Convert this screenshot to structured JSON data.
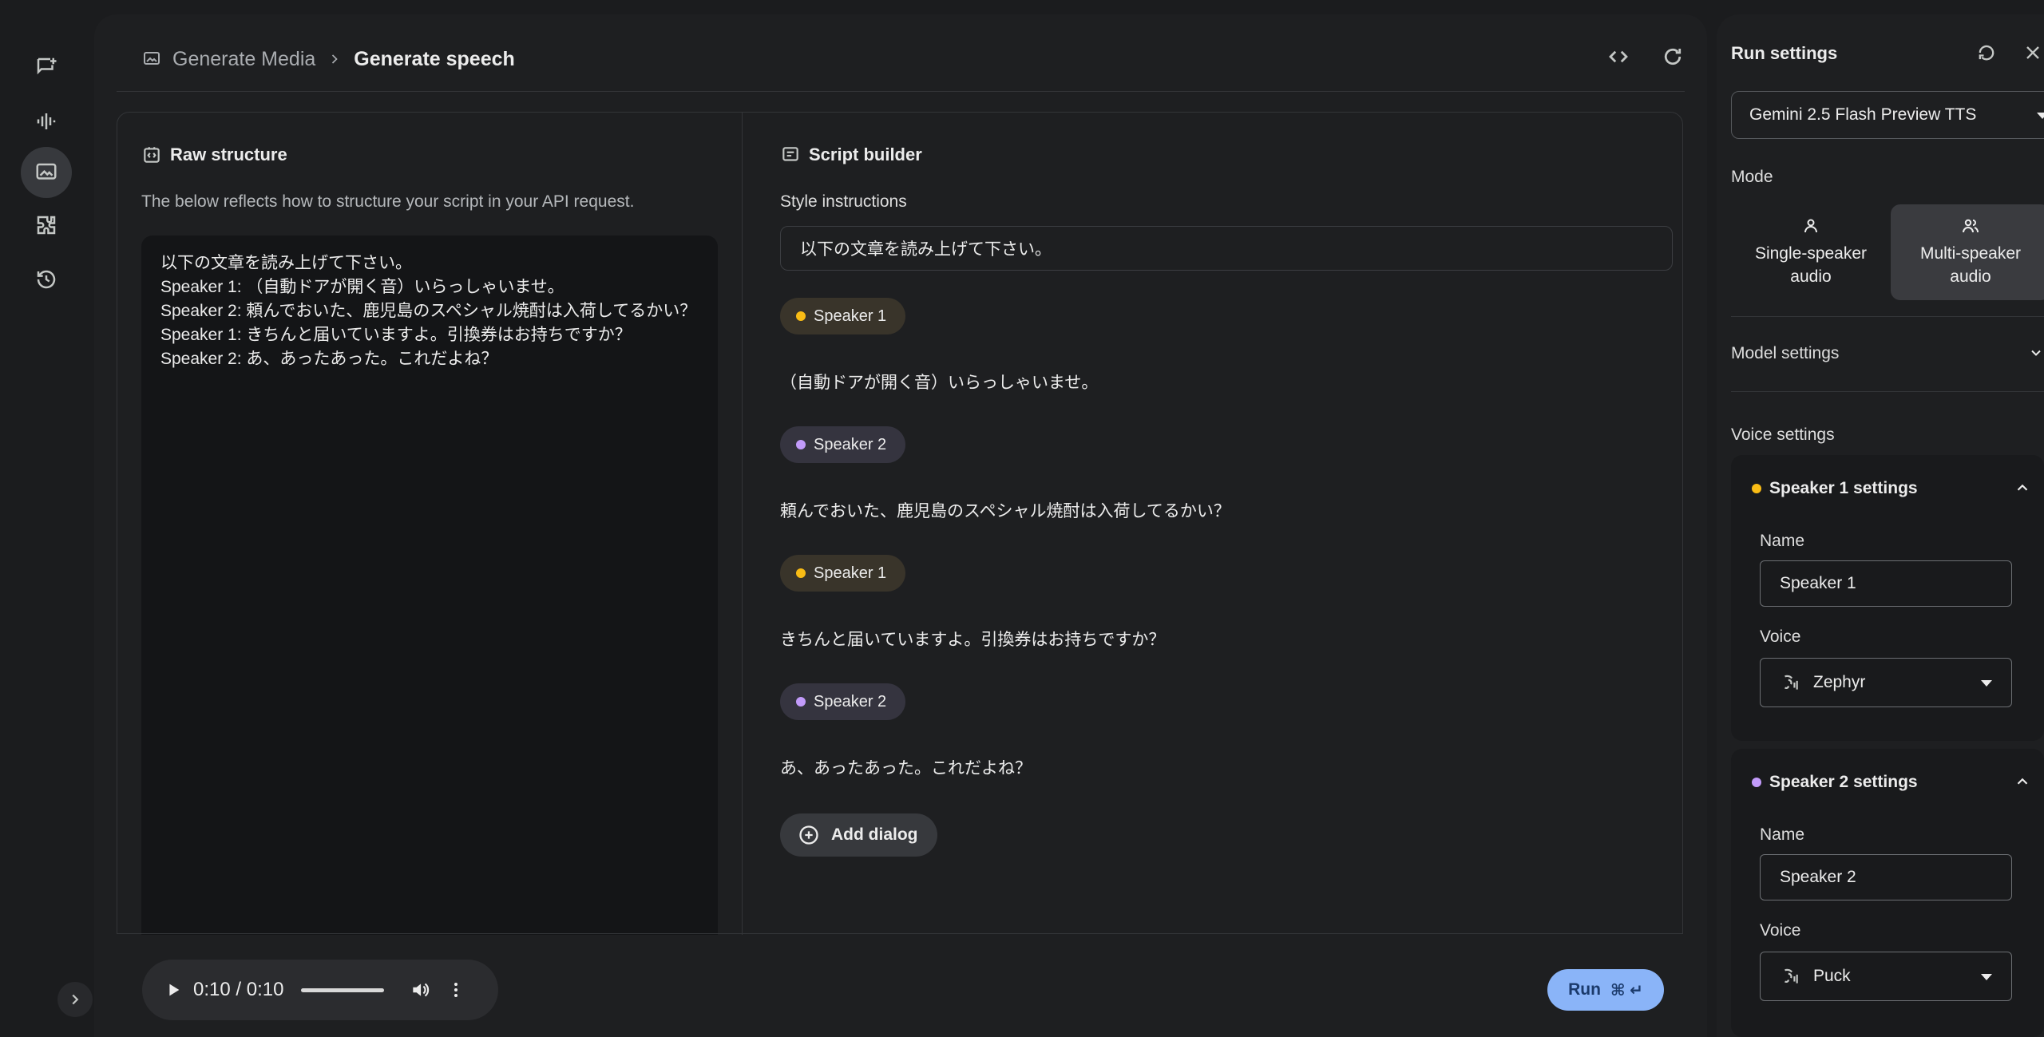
{
  "breadcrumb": {
    "parent": "Generate Media",
    "current": "Generate speech"
  },
  "raw_structure": {
    "title": "Raw structure",
    "description": "The below reflects how to structure your script in your API request.",
    "script_text": "以下の文章を読み上げて下さい。\nSpeaker 1: （自動ドアが開く音）いらっしゃいませ。\nSpeaker 2: 頼んでおいた、鹿児島のスペシャル焼酎は入荷してるかい？\nSpeaker 1: きちんと届いていますよ。引換券はお持ちですか？\nSpeaker 2: あ、あったあった。これだよね？"
  },
  "script_builder": {
    "title": "Script builder",
    "style_label": "Style instructions",
    "style_value": "以下の文章を読み上げて下さい。",
    "dialogs": [
      {
        "speaker": "Speaker 1",
        "text": "（自動ドアが開く音）いらっしゃいませ。"
      },
      {
        "speaker": "Speaker 2",
        "text": "頼んでおいた、鹿児島のスペシャル焼酎は入荷してるかい？"
      },
      {
        "speaker": "Speaker 1",
        "text": "きちんと届いていますよ。引換券はお持ちですか？"
      },
      {
        "speaker": "Speaker 2",
        "text": "あ、あったあった。これだよね？"
      }
    ],
    "add_dialog": "Add dialog"
  },
  "player": {
    "time": "0:10 / 0:10",
    "progress": 1.0
  },
  "run": {
    "label": "Run",
    "shortcut": "⌘ ↵"
  },
  "settings": {
    "title": "Run settings",
    "model": "Gemini 2.5 Flash Preview TTS",
    "mode_label": "Mode",
    "modes": [
      "Single-speaker\naudio",
      "Multi-speaker\naudio"
    ],
    "selected_mode": "Multi-speaker audio",
    "model_settings": "Model settings",
    "voice_settings": "Voice settings",
    "speakers": [
      {
        "title": "Speaker 1 settings",
        "name_label": "Name",
        "name": "Speaker 1",
        "voice_label": "Voice",
        "voice": "Zephyr"
      },
      {
        "title": "Speaker 2 settings",
        "name_label": "Name",
        "name": "Speaker 2",
        "voice_label": "Voice",
        "voice": "Puck"
      }
    ]
  },
  "colors": {
    "speaker1": "#f9bc15",
    "speaker2": "#c29bfa",
    "accent": "#8ab4f8"
  }
}
